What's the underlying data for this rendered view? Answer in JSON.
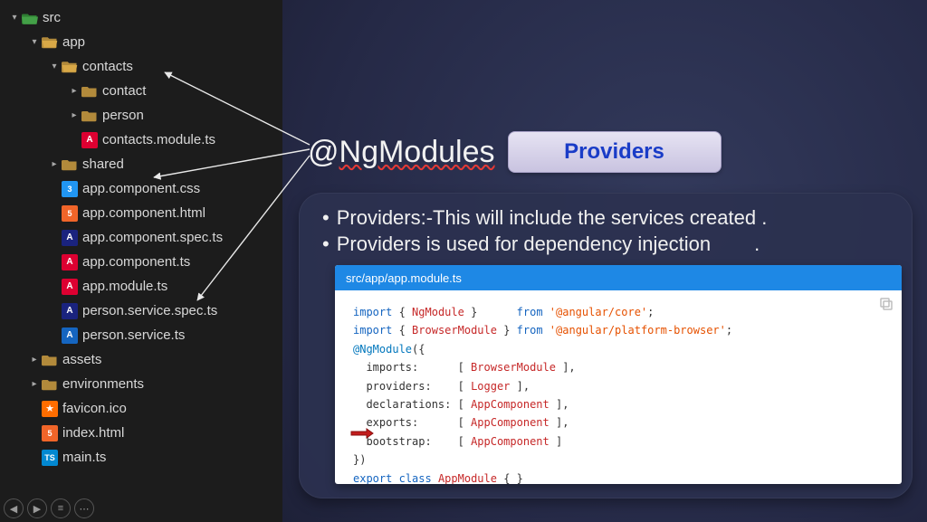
{
  "tree": {
    "src": "src",
    "app": "app",
    "contacts": "contacts",
    "contact": "contact",
    "person": "person",
    "contacts_module": "contacts.module.ts",
    "shared": "shared",
    "app_css": "app.component.css",
    "app_html": "app.component.html",
    "app_spec": "app.component.spec.ts",
    "app_component": "app.component.ts",
    "app_module": "app.module.ts",
    "person_spec": "person.service.spec.ts",
    "person_service": "person.service.ts",
    "assets": "assets",
    "environments": "environments",
    "favicon": "favicon.ico",
    "index_html": "index.html",
    "main_ts": "main.ts"
  },
  "icons": {
    "css3": "3",
    "html5": "5",
    "angular": "A",
    "ts": "TS",
    "star": "★"
  },
  "slide": {
    "title_prefix": "@",
    "title_main": "NgModules",
    "providers_button": "Providers",
    "bullet1": "Providers:-This will include the services created .",
    "bullet2": "Providers is used for dependency injection",
    "trailing_dot": "."
  },
  "code": {
    "filepath": "src/app/app.module.ts",
    "l1_a": "import",
    "l1_b": "NgModule",
    "l1_c": "from",
    "l1_d": "'@angular/core'",
    "l2_a": "import",
    "l2_b": "BrowserModule",
    "l2_c": "from",
    "l2_d": "'@angular/platform-browser'",
    "l3": "@NgModule",
    "p_imports": "imports:",
    "v_imports": "BrowserModule",
    "p_providers": "providers:",
    "v_providers": "Logger",
    "p_declarations": "declarations:",
    "v_declarations": "AppComponent",
    "p_exports": "exports:",
    "v_exports": "AppComponent",
    "p_bootstrap": "bootstrap:",
    "v_bootstrap": "AppComponent",
    "l_close": "})",
    "lx_a": "export",
    "lx_b": "class",
    "lx_c": "AppModule"
  }
}
